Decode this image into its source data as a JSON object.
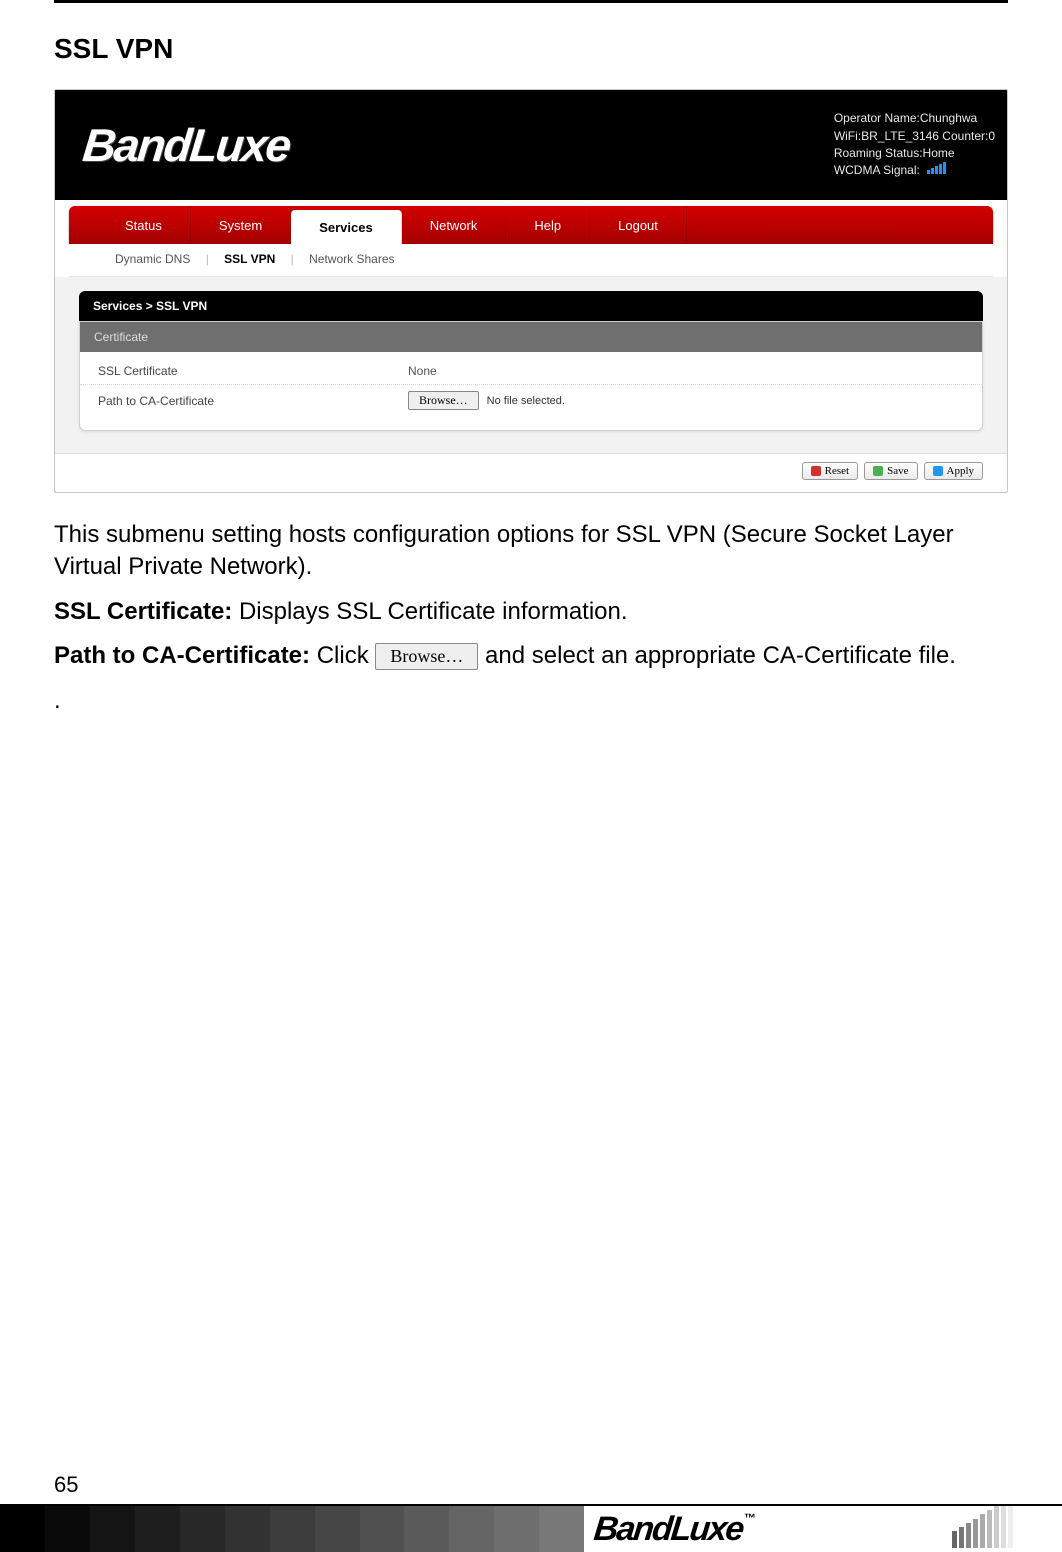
{
  "page": {
    "section_title": "SSL VPN",
    "page_number": "65",
    "footer_brand": "BandLuxe",
    "footer_tm": "™"
  },
  "screenshot": {
    "brand": "BandLuxe",
    "operator": {
      "name_line": "Operator Name:Chunghwa",
      "wifi_line": "WiFi:BR_LTE_3146 Counter:0",
      "roaming_line": "Roaming Status:Home",
      "signal_line": "WCDMA Signal:"
    },
    "nav": {
      "items": [
        "Status",
        "System",
        "Services",
        "Network",
        "Help",
        "Logout"
      ],
      "active_index": 2
    },
    "subnav": {
      "items": [
        "Dynamic DNS",
        "SSL VPN",
        "Network Shares"
      ],
      "active_index": 1
    },
    "breadcrumb": "Services > SSL VPN",
    "panel": {
      "title": "Certificate",
      "rows": {
        "ssl_cert_label": "SSL Certificate",
        "ssl_cert_value": "None",
        "path_label": "Path to CA-Certificate",
        "browse_label": "Browse…",
        "no_file_label": "No file selected."
      }
    },
    "actions": {
      "reset": "Reset",
      "save": "Save",
      "apply": "Apply"
    }
  },
  "copy": {
    "intro": "This submenu setting hosts configuration options for SSL VPN (Secure Socket Layer Virtual Private Network).",
    "ssl_cert_bold": "SSL Certificate:",
    "ssl_cert_rest": " Displays SSL Certificate information.",
    "path_bold": "Path to CA-Certificate:",
    "path_pre": " Click ",
    "path_browse": "Browse…",
    "path_post": " and select an appropriate CA-Certificate file.",
    "dot": "."
  }
}
